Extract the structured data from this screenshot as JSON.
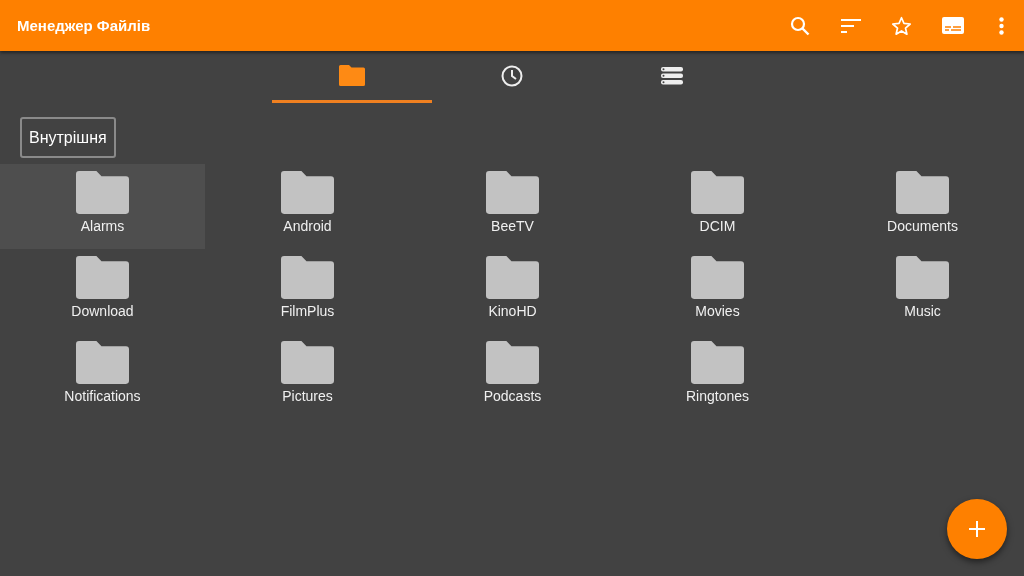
{
  "app_bar": {
    "title": "Менеджер Файлів"
  },
  "tabs": [
    {
      "kind": "folder",
      "selected": true
    },
    {
      "kind": "clock",
      "selected": false
    },
    {
      "kind": "storage",
      "selected": false
    }
  ],
  "breadcrumb": "Внутрішня",
  "folders": [
    {
      "name": "Alarms",
      "selected": true
    },
    {
      "name": "Android",
      "selected": false
    },
    {
      "name": "BeeTV",
      "selected": false
    },
    {
      "name": "DCIM",
      "selected": false
    },
    {
      "name": "Documents",
      "selected": false
    },
    {
      "name": "Download",
      "selected": false
    },
    {
      "name": "FilmPlus",
      "selected": false
    },
    {
      "name": "KinoHD",
      "selected": false
    },
    {
      "name": "Movies",
      "selected": false
    },
    {
      "name": "Music",
      "selected": false
    },
    {
      "name": "Notifications",
      "selected": false
    },
    {
      "name": "Pictures",
      "selected": false
    },
    {
      "name": "Podcasts",
      "selected": false
    },
    {
      "name": "Ringtones",
      "selected": false
    }
  ]
}
